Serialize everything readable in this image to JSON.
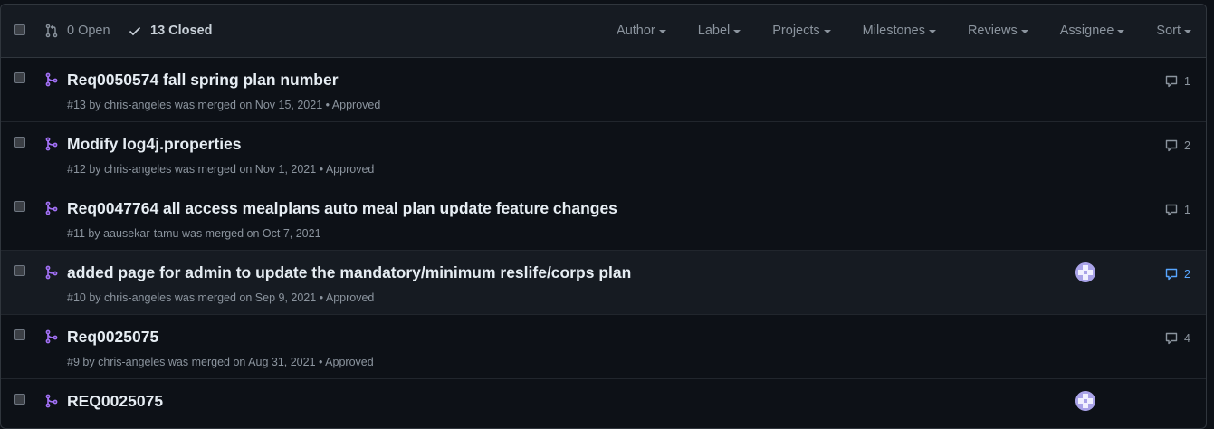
{
  "header": {
    "open_label": "0 Open",
    "closed_label": "13 Closed",
    "filters": [
      "Author",
      "Label",
      "Projects",
      "Milestones",
      "Reviews",
      "Assignee",
      "Sort"
    ]
  },
  "pull_requests": [
    {
      "title": "Req0050574 fall spring plan number",
      "number": "#13",
      "by": "by",
      "author": "chris-angeles",
      "merged_text": "was merged on Nov 15, 2021",
      "review": "• Approved",
      "comments": "1",
      "assignee_avatar": false
    },
    {
      "title": "Modify log4j.properties",
      "number": "#12",
      "by": "by",
      "author": "chris-angeles",
      "merged_text": "was merged on Nov 1, 2021",
      "review": "• Approved",
      "comments": "2",
      "assignee_avatar": false
    },
    {
      "title": "Req0047764 all access mealplans auto meal plan update feature changes",
      "number": "#11",
      "by": "by",
      "author": "aausekar-tamu",
      "merged_text": "was merged on Oct 7, 2021",
      "review": "",
      "comments": "1",
      "assignee_avatar": false
    },
    {
      "title": "added page for admin to update the mandatory/minimum reslife/corps plan",
      "number": "#10",
      "by": "by",
      "author": "chris-angeles",
      "merged_text": "was merged on Sep 9, 2021",
      "review": "• Approved",
      "comments": "2",
      "assignee_avatar": true
    },
    {
      "title": "Req0025075",
      "number": "#9",
      "by": "by",
      "author": "chris-angeles",
      "merged_text": "was merged on Aug 31, 2021",
      "review": "• Approved",
      "comments": "4",
      "assignee_avatar": false
    },
    {
      "title": "REQ0025075",
      "number": "",
      "by": "",
      "author": "",
      "merged_text": "",
      "review": "",
      "comments": "",
      "assignee_avatar": true
    }
  ],
  "colors": {
    "background": "#0d1117",
    "header_bg": "#161b22",
    "merged_icon": "#a371f7",
    "link_blue": "#58a6ff",
    "muted": "#8b949e"
  },
  "icons": {
    "open": "git-pull-request-icon",
    "closed": "check-icon",
    "merged": "git-merge-icon",
    "comment": "comment-icon"
  }
}
